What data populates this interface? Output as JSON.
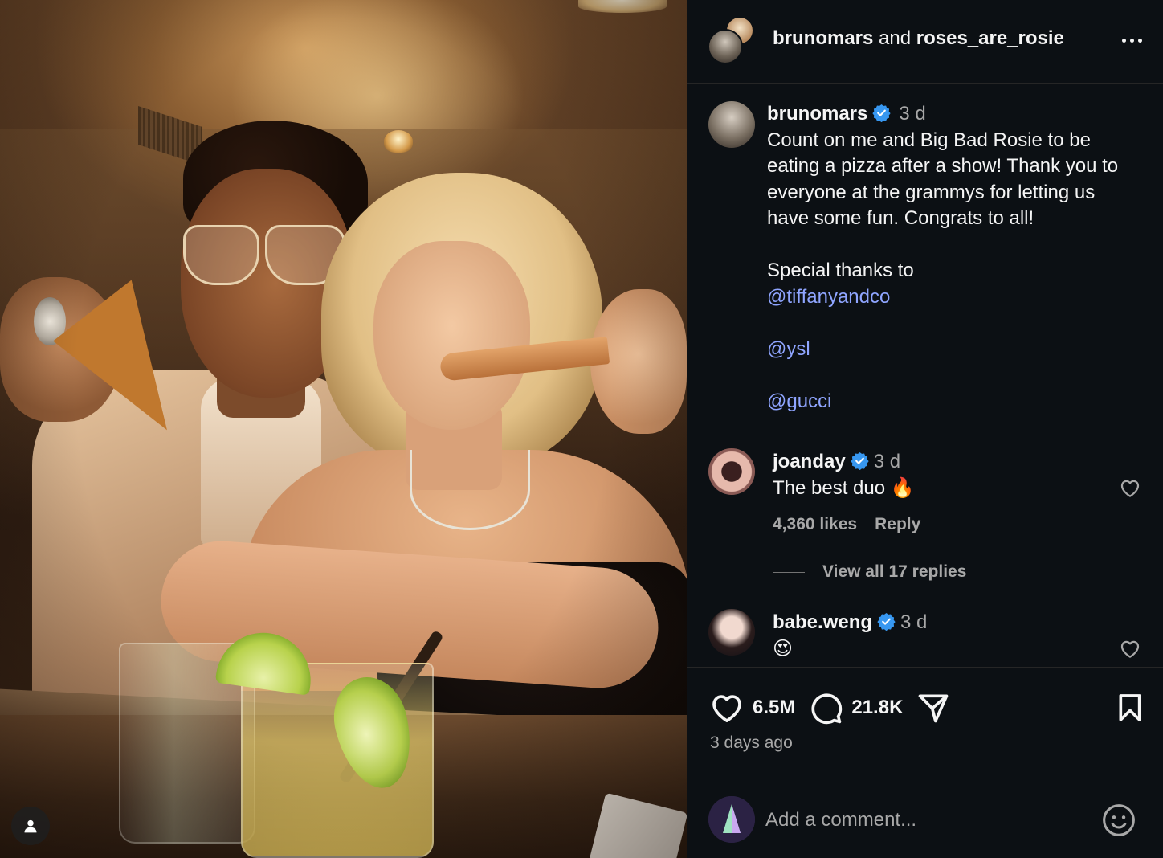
{
  "post": {
    "image_alt": "Photo",
    "tag_icon": "user-icon"
  },
  "header": {
    "user1": "brunomars",
    "joiner": " and ",
    "user2": "roses_are_rosie",
    "more_icon": "more-horizontal-icon"
  },
  "caption": {
    "username": "brunomars",
    "time": "3 d",
    "text": "Count on me and Big Bad Rosie to be eating a pizza after a show! Thank you to everyone at the grammys for letting us have some fun. Congrats to all!",
    "thanks": "Special thanks to",
    "mentions": [
      "@tiffanyandco",
      "@ysl",
      "@gucci"
    ]
  },
  "comments": [
    {
      "username": "joanday",
      "time": "3 d",
      "text": "The best duo 🔥",
      "likes": "4,360 likes",
      "reply": "Reply",
      "view_replies": "View all 17 replies"
    },
    {
      "username": "babe.weng",
      "time": "3 d",
      "text": "😍"
    }
  ],
  "actions": {
    "likes": "6.5M",
    "comments": "21.8K",
    "posted": "3 days ago"
  },
  "comment_box": {
    "placeholder": "Add a comment..."
  },
  "colors": {
    "background": "#0c1014",
    "link": "#8fa5ff",
    "verified": "#3797f0",
    "muted": "#a8a8a8"
  }
}
